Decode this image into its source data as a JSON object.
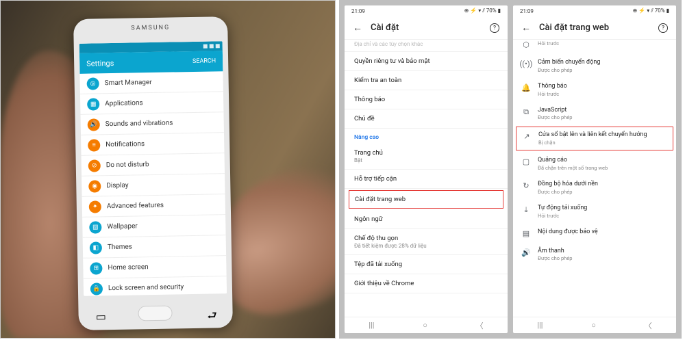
{
  "leftPhone": {
    "brand": "SAMSUNG",
    "headerTitle": "Settings",
    "headerAction": "SEARCH",
    "items": [
      {
        "label": "Smart Manager",
        "color": "teal",
        "glyph": "◎"
      },
      {
        "label": "Applications",
        "color": "teal",
        "glyph": "▦"
      },
      {
        "label": "Sounds and vibrations",
        "color": "orange",
        "glyph": "🔊"
      },
      {
        "label": "Notifications",
        "color": "orange",
        "glyph": "≡"
      },
      {
        "label": "Do not disturb",
        "color": "orange",
        "glyph": "⊘"
      },
      {
        "label": "Display",
        "color": "orange",
        "glyph": "◉"
      },
      {
        "label": "Advanced features",
        "color": "orange",
        "glyph": "✦"
      },
      {
        "label": "Wallpaper",
        "color": "teal",
        "glyph": "▨"
      },
      {
        "label": "Themes",
        "color": "teal",
        "glyph": "◧"
      },
      {
        "label": "Home screen",
        "color": "teal",
        "glyph": "⊞"
      },
      {
        "label": "Lock screen and security",
        "color": "teal",
        "glyph": "🔒"
      }
    ]
  },
  "chrome1": {
    "time": "21:09",
    "statusRight": "⊕ ⚡ ▾ ⫽ 70% ▮",
    "title": "Cài đặt",
    "topCut": "Địa chỉ và các tùy chọn khác",
    "rows": [
      {
        "label": "Quyền riêng tư và bảo mật"
      },
      {
        "label": "Kiểm tra an toàn"
      },
      {
        "label": "Thông báo"
      },
      {
        "label": "Chủ đề"
      }
    ],
    "section": "Nâng cao",
    "rows2": [
      {
        "label": "Trang chủ",
        "sub": "Bật"
      },
      {
        "label": "Hỗ trợ tiếp cận"
      },
      {
        "label": "Cài đặt trang web",
        "hl": true
      },
      {
        "label": "Ngôn ngữ"
      },
      {
        "label": "Chế độ thu gọn",
        "sub": "Đã tiết kiệm được 28% dữ liệu"
      },
      {
        "label": "Tệp đã tải xuống"
      },
      {
        "label": "Giới thiệu về Chrome"
      }
    ]
  },
  "chrome2": {
    "time": "21:09",
    "statusRight": "⊕ ⚡ ▾ ⫽ 70% ▮",
    "title": "Cài đặt trang web",
    "items": [
      {
        "icon": "⬡",
        "label": "",
        "sub": "Hỏi trước",
        "cut": true
      },
      {
        "icon": "((•))",
        "label": "Cảm biến chuyển động",
        "sub": "Được cho phép"
      },
      {
        "icon": "🔔",
        "label": "Thông báo",
        "sub": "Hỏi trước"
      },
      {
        "icon": "⧉",
        "label": "JavaScript",
        "sub": "Được cho phép"
      },
      {
        "icon": "↗",
        "label": "Cửa sổ bật lên và liên kết chuyển hướng",
        "sub": "Bị chặn",
        "hl": true
      },
      {
        "icon": "▢",
        "label": "Quảng cáo",
        "sub": "Đã chặn trên một số trang web"
      },
      {
        "icon": "↻",
        "label": "Đồng bộ hóa dưới nền",
        "sub": "Được cho phép"
      },
      {
        "icon": "⤓",
        "label": "Tự động tải xuống",
        "sub": "Hỏi trước"
      },
      {
        "icon": "▤",
        "label": "Nội dung được bảo vệ",
        "sub": ""
      },
      {
        "icon": "🔊",
        "label": "Âm thanh",
        "sub": "Được cho phép"
      }
    ]
  }
}
